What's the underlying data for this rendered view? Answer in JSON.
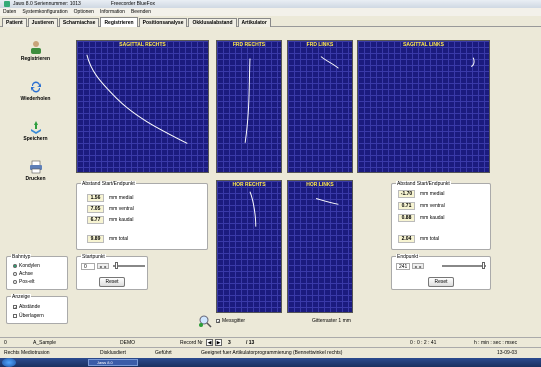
{
  "window": {
    "title": "Jaws 8.0  Seriennummer: 1013",
    "subtitle": "Freecorder BlueFox"
  },
  "menu": [
    "Daten",
    "Systemkonfiguration",
    "Optionen",
    "Information",
    "Beenden"
  ],
  "tabs": [
    "Patient",
    "Justieren",
    "Scharniachse",
    "Registrieren",
    "Positionsanalyse",
    "Okklusalabstand",
    "Artikulator"
  ],
  "active_tab": "Registrieren",
  "sidebar": {
    "registrieren": "Registrieren",
    "wiederholen": "Wiederholen",
    "speichern": "Speichern",
    "drucken": "Drucken"
  },
  "panels": {
    "sagittal_rechts": "SAGITTAL RECHTS",
    "frd_rechts": "FRD RECHTS",
    "frd_links": "FRD LINKS",
    "sagittal_links": "SAGITTAL LINKS",
    "hor_rechts": "HOR RECHTS",
    "hor_links": "HOR LINKS"
  },
  "left_group": {
    "title": "Abstand Start/Endpunkt",
    "values": [
      {
        "value": "1.56",
        "unit": "mm medial"
      },
      {
        "value": "7.05",
        "unit": "mm ventral"
      },
      {
        "value": "6.77",
        "unit": "mm kaudal"
      }
    ],
    "total": {
      "value": "9.89",
      "unit": "mm total"
    }
  },
  "right_group": {
    "title": "Abstand Start/Endpunkt",
    "values": [
      {
        "value": "-1.70",
        "unit": "mm medial"
      },
      {
        "value": "0.71",
        "unit": "mm ventral"
      },
      {
        "value": "0.88",
        "unit": "mm kaudal"
      }
    ],
    "total": {
      "value": "2.04",
      "unit": "mm total"
    }
  },
  "startpunkt": {
    "label": "Startpunkt",
    "value": "0",
    "reset": "Reset",
    "position": 0.05
  },
  "endpunkt": {
    "label": "Endpunkt",
    "value": "241",
    "reset": "Reset",
    "position": 0.98
  },
  "bahntyp": {
    "title": "Bahntyp",
    "options": [
      "Kondylen",
      "Achse",
      "Pos-elt"
    ],
    "selected": "Kondylen"
  },
  "anzeige": {
    "title": "Anzeige",
    "options": [
      {
        "label": "Abstände",
        "checked": true
      },
      {
        "label": "Überlagern",
        "checked": false
      }
    ]
  },
  "messgitter": {
    "label": "Messgitter",
    "checked": true
  },
  "grid_info": "Gitterraster 1 mm",
  "status1": {
    "left_num": "0",
    "sample": "A_Sample",
    "demo": "DEMO",
    "record_label": "Record Nr",
    "record_value": "3",
    "record_total": "/ 13",
    "time": "0 : 0 : 2 : 41",
    "time_format": "h : min : sec : msec"
  },
  "status2": {
    "left": "Rechts Mediotrusion",
    "c2": "Disklusdiert",
    "c3": "Geführt",
    "message": "Geeignet fuer Artikulatorprogrammierung (Bennettwinkel rechts)",
    "date": "13-09-03"
  },
  "taskbar": {
    "item": "Jaws 8.0"
  }
}
